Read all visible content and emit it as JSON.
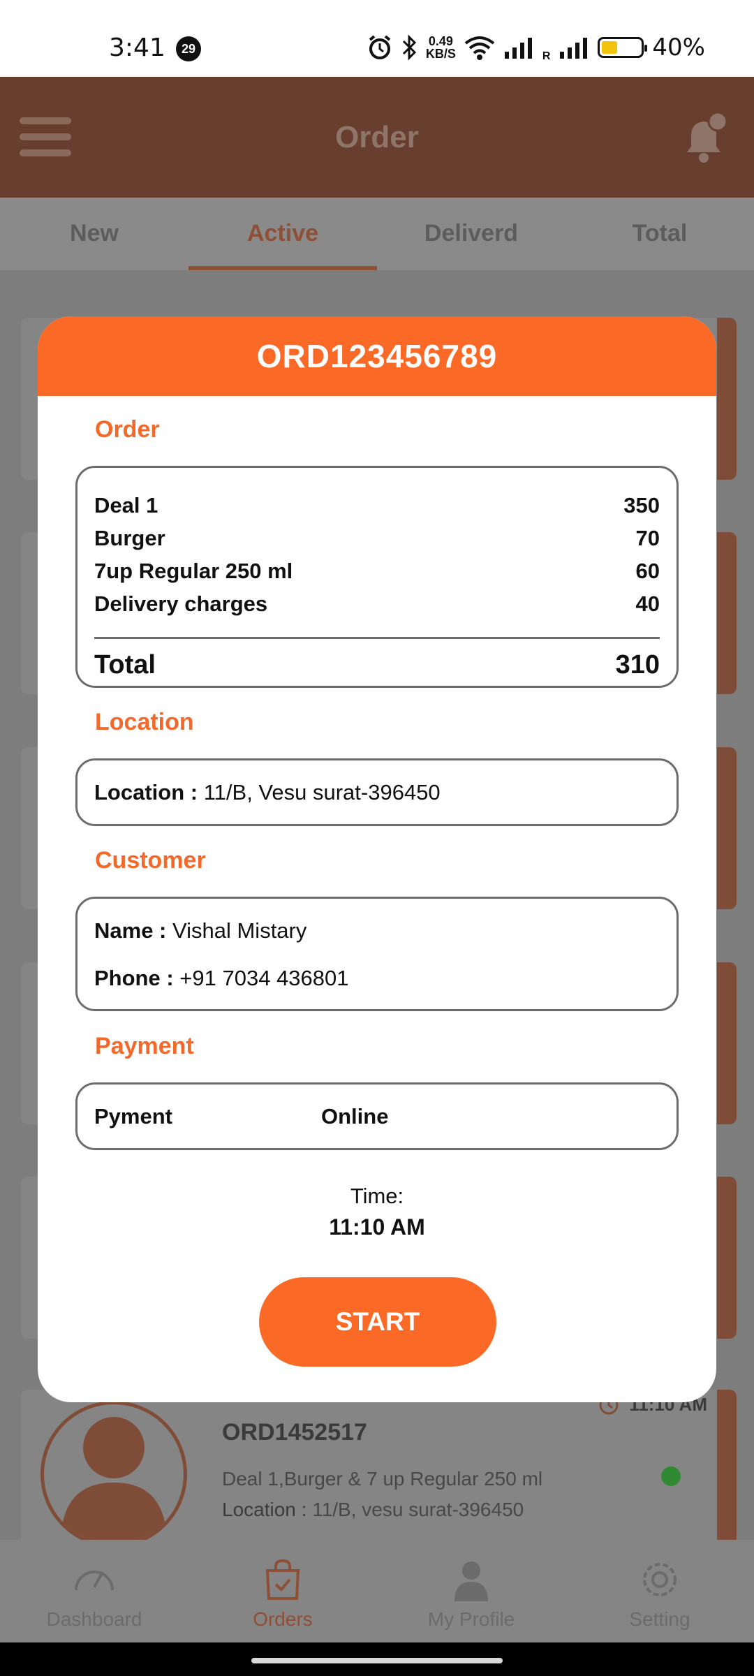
{
  "status_bar": {
    "time": "3:41",
    "notification_count": "29",
    "net_speed_value": "0.49",
    "net_speed_unit": "KB/S",
    "roaming_label": "R",
    "battery": "40%"
  },
  "header": {
    "title": "Order"
  },
  "tabs": [
    {
      "label": "New"
    },
    {
      "label": "Active"
    },
    {
      "label": "Deliverd"
    },
    {
      "label": "Total"
    }
  ],
  "active_tab": "Active",
  "background_card": {
    "order_id": "ORD1452517",
    "time": "11:10 AM",
    "items": "Deal 1,Burger & 7 up Regular 250 ml",
    "location_label": "Location :",
    "location_value": "11/B, vesu surat-396450"
  },
  "modal": {
    "order_id": "ORD123456789",
    "order_section": {
      "title": "Order",
      "items": [
        {
          "name": "Deal 1",
          "price": "350"
        },
        {
          "name": "Burger",
          "price": "70"
        },
        {
          "name": "7up Regular 250 ml",
          "price": "60"
        },
        {
          "name": "Delivery charges",
          "price": "40"
        }
      ],
      "total_label": "Total",
      "total_value": "310"
    },
    "location_section": {
      "title": "Location",
      "label": "Location :",
      "value": "11/B, Vesu surat-396450"
    },
    "customer_section": {
      "title": "Customer",
      "name_label": "Name :",
      "name_value": "Vishal Mistary",
      "phone_label": "Phone :",
      "phone_value": "+91 7034 436801"
    },
    "payment_section": {
      "title": "Payment",
      "label": "Pyment",
      "value": "Online"
    },
    "time_label": "Time:",
    "time_value": "11:10 AM",
    "start_button": "START"
  },
  "bottom_nav": [
    {
      "label": "Dashboard",
      "icon": "dashboard-icon"
    },
    {
      "label": "Orders",
      "icon": "orders-icon"
    },
    {
      "label": "My Profile",
      "icon": "profile-icon"
    },
    {
      "label": "Setting",
      "icon": "settings-icon"
    }
  ],
  "colors": {
    "accent": "#fa6a26",
    "header_bg": "#683f2e",
    "online_dot": "#2f8a33"
  }
}
